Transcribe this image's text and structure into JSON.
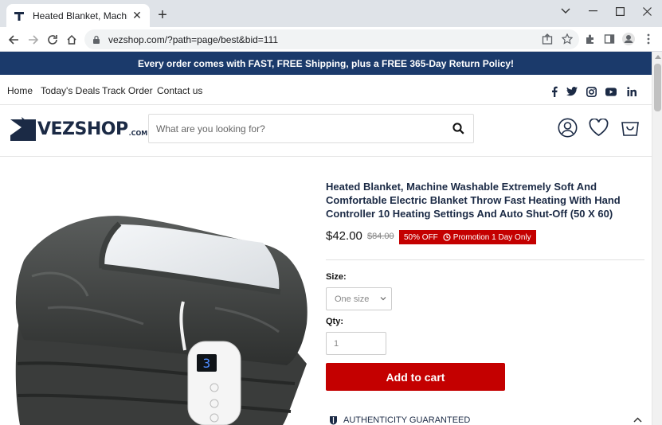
{
  "browser": {
    "tab_title": "Heated Blanket, Machine Washab",
    "url": "vezshop.com/?path=page/best&bid=111"
  },
  "promo_bar": {
    "text": "Every order comes with FAST, FREE Shipping, plus a FREE 365-Day Return Policy!"
  },
  "nav": {
    "links": [
      "Home",
      "Today's Deals",
      "Track Order",
      "Contact us"
    ],
    "social": [
      "facebook-icon",
      "twitter-icon",
      "instagram-icon",
      "youtube-icon",
      "linkedin-icon"
    ]
  },
  "header": {
    "logo_word": "VEZSHOP",
    "logo_domain": ".COM",
    "search_placeholder": "What are you looking for?"
  },
  "product": {
    "title": "Heated Blanket, Machine Washable Extremely Soft And Comfortable Electric Blanket Throw Fast Heating With Hand Controller 10 Heating Settings And Auto Shut-Off (50 X 60)",
    "price": "$42.00",
    "old_price": "$84.00",
    "badge_off": "50% OFF",
    "badge_promo": "Promotion 1 Day Only",
    "size_label": "Size:",
    "size_value": "One size",
    "qty_label": "Qty:",
    "qty_value": "1",
    "add_to_cart": "Add to cart",
    "authenticity": "AUTHENTICITY GUARANTEED",
    "controller_display": "3"
  },
  "colors": {
    "promo_bg": "#1b3a6b",
    "brand_navy": "#1b2a45",
    "accent_red": "#c40000"
  }
}
